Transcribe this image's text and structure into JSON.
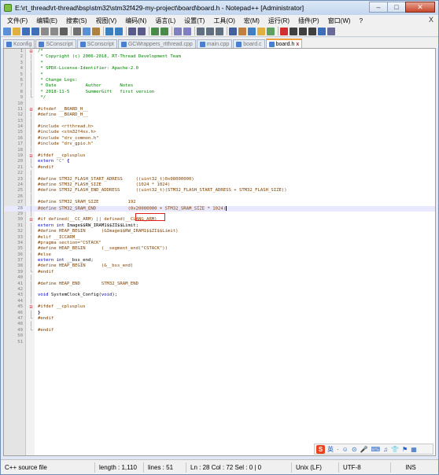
{
  "window": {
    "title": "E:\\rt_thread\\rt-thread\\bsp\\stm32\\stm32f429-my-project\\board\\board.h - Notepad++ [Administrator]",
    "minimize": "–",
    "maximize": "□",
    "close": "✕"
  },
  "menu": {
    "items": [
      "文件(F)",
      "编辑(E)",
      "搜索(S)",
      "视图(V)",
      "编码(N)",
      "语言(L)",
      "设置(T)",
      "工具(O)",
      "宏(M)",
      "运行(R)",
      "插件(P)",
      "窗口(W)",
      "?"
    ],
    "close_glyph": "X"
  },
  "toolbar": {
    "buttons": [
      {
        "name": "new-file",
        "color": "#5b8fd6"
      },
      {
        "name": "open-file",
        "color": "#e0b040"
      },
      {
        "name": "save",
        "color": "#3d6fb8"
      },
      {
        "name": "save-all",
        "color": "#3d6fb8"
      },
      {
        "name": "close",
        "color": "#8a8a8a"
      },
      {
        "name": "close-all",
        "color": "#8a8a8a"
      },
      {
        "name": "print",
        "color": "#606060"
      },
      {
        "sep": true
      },
      {
        "name": "cut",
        "color": "#707070"
      },
      {
        "name": "copy",
        "color": "#5b8fd6"
      },
      {
        "name": "paste",
        "color": "#b08040"
      },
      {
        "sep": true
      },
      {
        "name": "undo",
        "color": "#3a80c0"
      },
      {
        "name": "redo",
        "color": "#3a80c0"
      },
      {
        "sep": true
      },
      {
        "name": "find",
        "color": "#5a5a8a"
      },
      {
        "name": "replace",
        "color": "#5a5a8a"
      },
      {
        "sep": true
      },
      {
        "name": "zoom-in",
        "color": "#4a8a4a"
      },
      {
        "name": "zoom-out",
        "color": "#4a8a4a"
      },
      {
        "sep": true
      },
      {
        "name": "sync-v",
        "color": "#8080c0"
      },
      {
        "name": "sync-h",
        "color": "#8080c0"
      },
      {
        "sep": true
      },
      {
        "name": "word-wrap",
        "color": "#607080"
      },
      {
        "name": "all-chars",
        "color": "#607080"
      },
      {
        "name": "indent-guide",
        "color": "#607080"
      },
      {
        "sep": true
      },
      {
        "name": "lang-define",
        "color": "#4060a0"
      },
      {
        "name": "doc-map",
        "color": "#c08040"
      },
      {
        "name": "func-list",
        "color": "#4080c0"
      },
      {
        "name": "folder-workspace",
        "color": "#e0b040"
      },
      {
        "name": "monitor",
        "color": "#60a060"
      },
      {
        "sep": true
      },
      {
        "name": "record",
        "color": "#d03030"
      },
      {
        "name": "stop",
        "color": "#404040"
      },
      {
        "name": "play",
        "color": "#404040"
      },
      {
        "name": "play-multi",
        "color": "#404040"
      },
      {
        "name": "save-macro",
        "color": "#3d6fb8"
      },
      {
        "name": "spell",
        "color": "#6a6a9a"
      }
    ]
  },
  "tabs": [
    {
      "label": "Kconfig",
      "active": false
    },
    {
      "label": "SConscript",
      "active": false
    },
    {
      "label": "SConscript",
      "active": false
    },
    {
      "label": "GCWrappers_rtthread.cpp",
      "active": false
    },
    {
      "label": "main.cpp",
      "active": false
    },
    {
      "label": "board.c",
      "active": false
    },
    {
      "label": "board.h",
      "active": true
    }
  ],
  "editor": {
    "current_line": 28,
    "lines": [
      {
        "n": "1",
        "f": "minus",
        "html": "<span class=\"cmt\">/*</span>"
      },
      {
        "n": "2",
        "f": "bar",
        "html": "<span class=\"cmt\"> * Copyright (c) 2006-2018, RT-Thread Development Team</span>"
      },
      {
        "n": "3",
        "f": "bar",
        "html": "<span class=\"cmt\"> *</span>"
      },
      {
        "n": "4",
        "f": "bar",
        "html": "<span class=\"cmt\"> * SPDX-License-Identifier: Apache-2.0</span>"
      },
      {
        "n": "5",
        "f": "bar",
        "html": "<span class=\"cmt\"> *</span>"
      },
      {
        "n": "6",
        "f": "bar",
        "html": "<span class=\"cmt\"> * Change Logs:</span>"
      },
      {
        "n": "7",
        "f": "bar",
        "html": "<span class=\"cmt\"> * Date           Author       Notes</span>"
      },
      {
        "n": "8",
        "f": "bar",
        "html": "<span class=\"cmt\"> * 2018-11-5      SummerGift   first version</span>"
      },
      {
        "n": "9",
        "f": "end",
        "html": "<span class=\"cmt\"> */</span>"
      },
      {
        "n": "10",
        "f": "",
        "html": ""
      },
      {
        "n": "11",
        "f": "box",
        "html": "<span class=\"pp\">#ifndef __BOARD_H__</span>"
      },
      {
        "n": "12",
        "f": "bar",
        "html": "<span class=\"pp\">#define __BOARD_H__</span>"
      },
      {
        "n": "13",
        "f": "bar",
        "html": ""
      },
      {
        "n": "14",
        "f": "bar",
        "html": "<span class=\"pp\">#include &lt;rtthread.h&gt;</span>"
      },
      {
        "n": "15",
        "f": "bar",
        "html": "<span class=\"pp\">#include &lt;stm32f4xx.h&gt;</span>"
      },
      {
        "n": "16",
        "f": "bar",
        "html": "<span class=\"pp\">#include \"drv_common.h\"</span>"
      },
      {
        "n": "17",
        "f": "bar",
        "html": "<span class=\"pp\">#include \"drv_gpio.h\"</span>"
      },
      {
        "n": "18",
        "f": "bar",
        "html": ""
      },
      {
        "n": "19",
        "f": "box",
        "html": "<span class=\"pp\">#ifdef __cplusplus</span>"
      },
      {
        "n": "20",
        "f": "bar",
        "html": "<span class=\"kw\">extern</span> <span class=\"str\">\"C\"</span> <span class=\"op\">{</span>"
      },
      {
        "n": "21",
        "f": "end",
        "html": "<span class=\"pp\">#endif</span>"
      },
      {
        "n": "22",
        "f": "bar",
        "html": ""
      },
      {
        "n": "23",
        "f": "bar",
        "html": "<span class=\"pp\">#define STM32_FLASH_START_ADRESS     ((uint32_t)0x08000000)</span>"
      },
      {
        "n": "24",
        "f": "bar",
        "html": "<span class=\"pp\">#define STM32_FLASH_SIZE             (1024 * 1024)</span>"
      },
      {
        "n": "25",
        "f": "bar",
        "html": "<span class=\"pp\">#define STM32_FLASH_END_ADDRESS      ((uint32_t)(STM32_FLASH_START_ADRESS + STM32_FLASH_SIZE))</span>"
      },
      {
        "n": "26",
        "f": "bar",
        "html": ""
      },
      {
        "n": "27",
        "f": "bar",
        "html": "<span class=\"pp\">#define STM32_SRAM_SIZE           192</span>"
      },
      {
        "n": "28",
        "f": "bar",
        "html": "<span class=\"pp\">#define STM32_SRAM_END            (0x20000000 + STM32_SRAM_SIZE * 1024)</span><span class=\"cursor\"></span>"
      },
      {
        "n": "29",
        "f": "bar",
        "html": ""
      },
      {
        "n": "30",
        "f": "box",
        "html": "<span class=\"pp\">#if defined(__CC_ARM) || defined(__CLANG_ARM)</span>"
      },
      {
        "n": "31",
        "f": "bar",
        "html": "<span class=\"kw\">extern</span> <span class=\"kw\">int</span> Image$$RW_IRAM1$$ZI$$Limit;"
      },
      {
        "n": "32",
        "f": "bar",
        "html": "<span class=\"pp\">#define HEAP_BEGIN      (&amp;Image$$RW_IRAM1$$ZI$$Limit)</span>"
      },
      {
        "n": "33",
        "f": "bar",
        "html": "<span class=\"pp\">#elif __ICCARM__</span>"
      },
      {
        "n": "34",
        "f": "bar",
        "html": "<span class=\"pp\">#pragma section=\"CSTACK\"</span>"
      },
      {
        "n": "35",
        "f": "bar",
        "html": "<span class=\"pp\">#define HEAP_BEGIN      (__segment_end(\"CSTACK\"))</span>"
      },
      {
        "n": "36",
        "f": "bar",
        "html": "<span class=\"pp\">#else</span>"
      },
      {
        "n": "37",
        "f": "bar",
        "html": "<span class=\"kw\">extern</span> <span class=\"kw\">int</span> __bss_end;"
      },
      {
        "n": "38",
        "f": "bar",
        "html": "<span class=\"pp\">#define HEAP_BEGIN      (&amp;__bss_end)</span>"
      },
      {
        "n": "39",
        "f": "end",
        "html": "<span class=\"pp\">#endif</span>"
      },
      {
        "n": "40",
        "f": "bar",
        "html": ""
      },
      {
        "n": "41",
        "f": "bar",
        "html": "<span class=\"pp\">#define HEAP_END        STM32_SRAM_END</span>"
      },
      {
        "n": "42",
        "f": "bar",
        "html": ""
      },
      {
        "n": "43",
        "f": "bar",
        "html": "<span class=\"kw\">void</span> SystemClock_Config(<span class=\"kw\">void</span>);"
      },
      {
        "n": "44",
        "f": "bar",
        "html": ""
      },
      {
        "n": "45",
        "f": "box",
        "html": "<span class=\"pp\">#ifdef __cplusplus</span>"
      },
      {
        "n": "46",
        "f": "bar",
        "html": "<span class=\"op\">}</span>"
      },
      {
        "n": "47",
        "f": "end",
        "html": "<span class=\"pp\">#endif</span>"
      },
      {
        "n": "48",
        "f": "bar",
        "html": ""
      },
      {
        "n": "49",
        "f": "end",
        "html": "<span class=\"pp\">#endif</span>"
      },
      {
        "n": "50",
        "f": "",
        "html": ""
      },
      {
        "n": "51",
        "f": "",
        "html": ""
      }
    ]
  },
  "ime": {
    "logo": "S",
    "items": [
      "英",
      "·",
      "☺",
      "⊙",
      "🎤",
      "⌨",
      "♫",
      "👕",
      "⚑",
      "▦"
    ]
  },
  "status": {
    "language": "C++ source file",
    "length": "length : 1,110",
    "lines": "lines : 51",
    "position": "Ln : 28   Col : 72   Sel : 0 | 0",
    "eol": "Unix (LF)",
    "encoding": "UTF-8",
    "mode": "INS"
  }
}
